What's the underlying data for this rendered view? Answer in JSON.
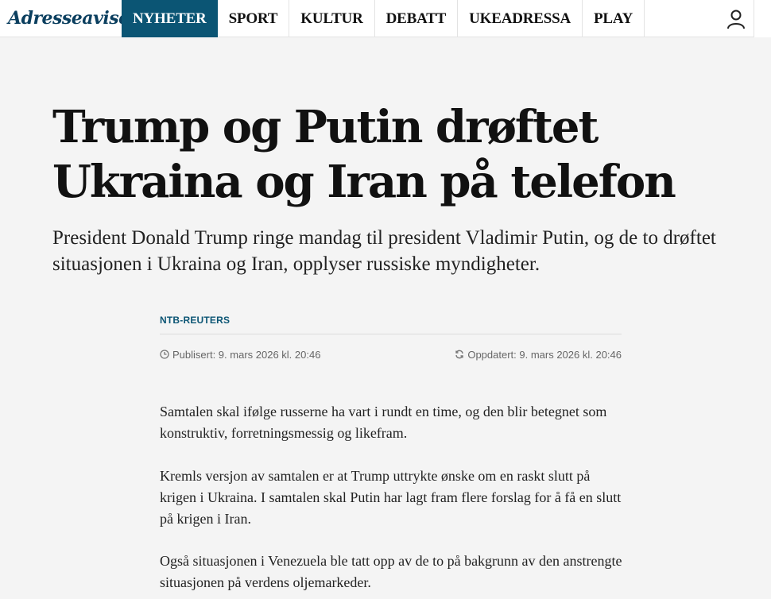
{
  "header": {
    "logo_text": "Adresseavisen",
    "nav": [
      {
        "label": "NYHETER",
        "active": true
      },
      {
        "label": "SPORT",
        "active": false
      },
      {
        "label": "KULTUR",
        "active": false
      },
      {
        "label": "DEBATT",
        "active": false
      },
      {
        "label": "UKEADRESSA",
        "active": false
      },
      {
        "label": "PLAY",
        "active": false
      }
    ],
    "user_icon": "user-icon"
  },
  "article": {
    "headline_line1": "Trump og Putin drøftet",
    "headline_line2": "Ukraina og Iran på telefon",
    "lead": "President Donald Trump ringe mandag til president Vladimir Putin, og de to drøftet situasjonen i Ukraina og Iran, opplyser russiske myndigheter.",
    "byline": "NTB-REUTERS",
    "published": "Publisert: 9. mars 2026 kl. 20:46",
    "updated": "Oppdatert: 9. mars 2026 kl. 20:46",
    "paragraphs": [
      "Samtalen skal ifølge russerne ha vart i rundt en time, og den blir betegnet som konstruktiv, forretningsmessig og likefram.",
      "Kremls versjon av samtalen er at Trump uttrykte ønske om en raskt slutt på krigen i Ukraina. I samtalen skal Putin har lagt fram flere forslag for å få en slutt på krigen i Iran.",
      "Også situasjonen i Venezuela ble tatt opp av de to på bakgrunn av den anstrengte situasjonen på verdens oljemarkeder."
    ]
  },
  "colors": {
    "brand": "#0b5574",
    "background": "#f4f4f4"
  }
}
